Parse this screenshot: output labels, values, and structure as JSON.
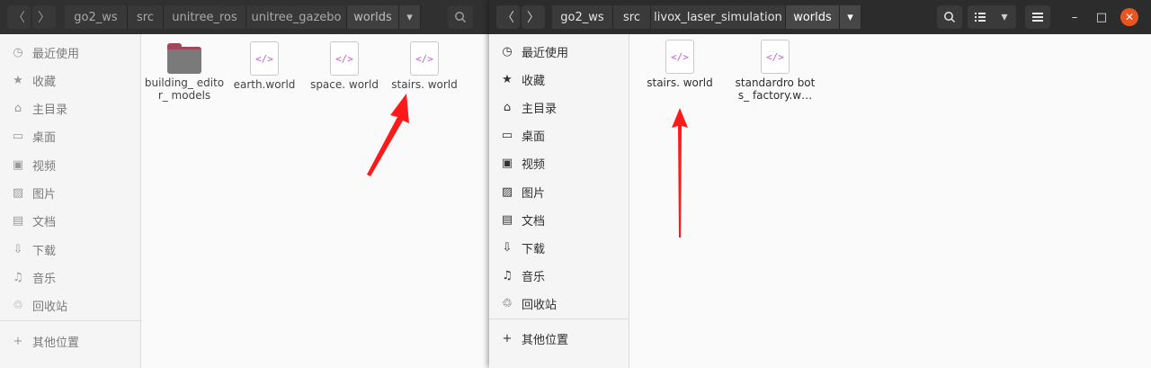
{
  "window_back": {
    "nav": {
      "back": "〈",
      "forward": "〉"
    },
    "breadcrumbs": [
      "go2_ws",
      "src",
      "unitree_ros",
      "unitree_gazebo",
      "worlds"
    ],
    "menu_caret": "▾",
    "sidebar": [
      "最近使用",
      "收藏",
      "主目录",
      "桌面",
      "视频",
      "图片",
      "文档",
      "下载",
      "音乐",
      "回收站"
    ],
    "sidebar_icons": [
      "recent-icon",
      "star-icon",
      "home-icon",
      "desktop-icon",
      "video-icon",
      "picture-icon",
      "document-icon",
      "download-icon",
      "music-icon",
      "trash-icon"
    ],
    "other_locations": "其他位置",
    "files": [
      {
        "name": "building_ editor_ models",
        "type": "folder"
      },
      {
        "name": "earth.world",
        "type": "xml"
      },
      {
        "name": "space. world",
        "type": "xml"
      },
      {
        "name": "stairs. world",
        "type": "xml"
      }
    ]
  },
  "window_front": {
    "nav": {
      "back": "〈",
      "forward": "〉"
    },
    "breadcrumbs": [
      "go2_ws",
      "src",
      "livox_laser_simulation",
      "worlds"
    ],
    "menu_caret": "▾",
    "sidebar": [
      "最近使用",
      "收藏",
      "主目录",
      "桌面",
      "视频",
      "图片",
      "文档",
      "下载",
      "音乐",
      "回收站"
    ],
    "sidebar_icons": [
      "recent-icon",
      "star-icon",
      "home-icon",
      "desktop-icon",
      "video-icon",
      "picture-icon",
      "document-icon",
      "download-icon",
      "music-icon",
      "trash-icon"
    ],
    "other_locations": "其他位置",
    "files": [
      {
        "name": "stairs. world",
        "type": "xml"
      },
      {
        "name": "standardro bots_ factory.w…",
        "type": "xml"
      }
    ],
    "controls": {
      "minimize": "–",
      "maximize": "□",
      "close": "✕"
    }
  },
  "xml_glyph": "</>",
  "accent_colors": {
    "close": "#e95420",
    "xml_icon": "#c05fd1",
    "arrow": "#ff1a1a"
  }
}
